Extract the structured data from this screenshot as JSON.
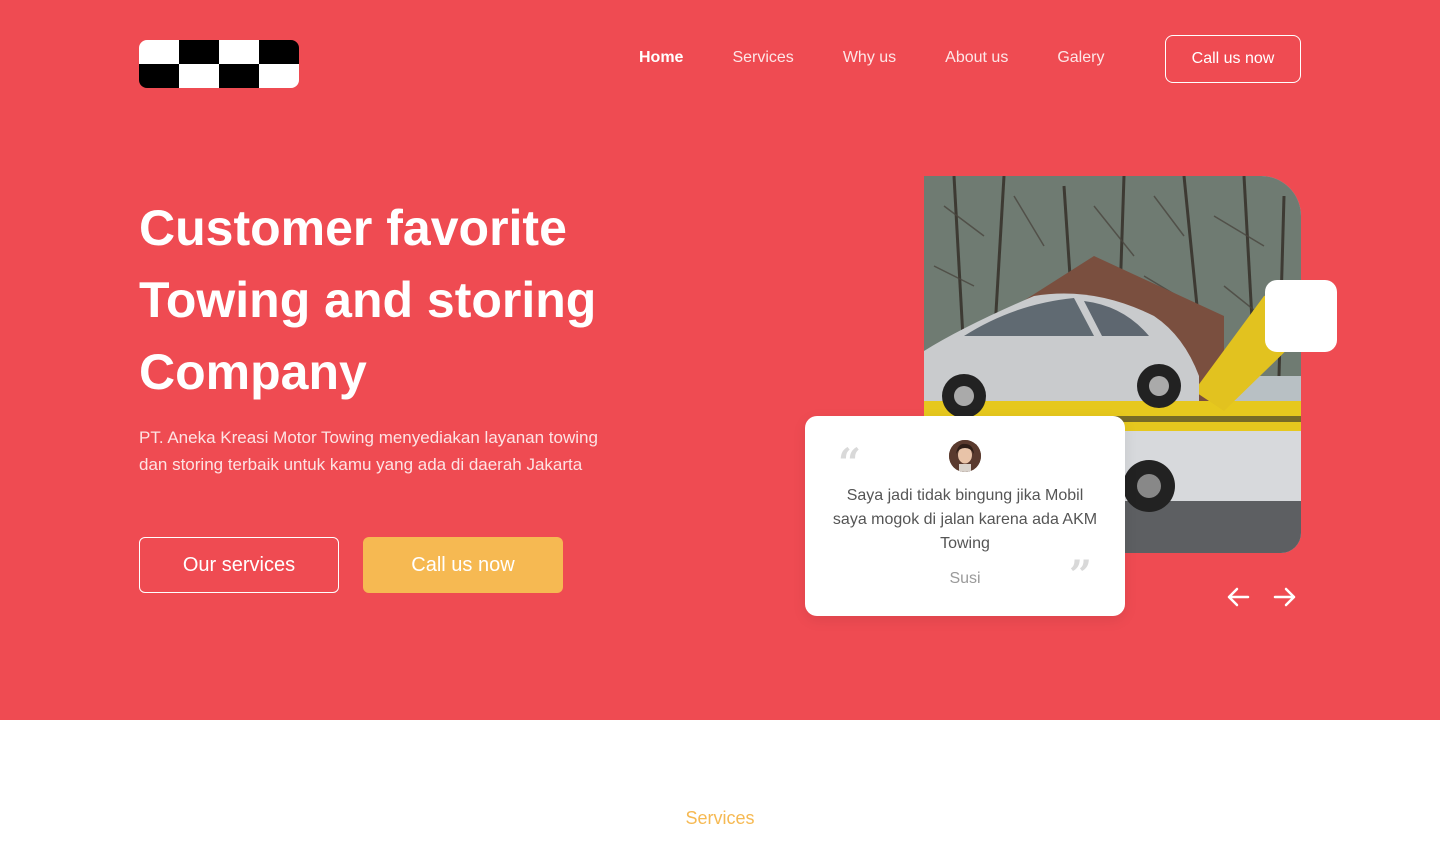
{
  "header": {
    "logo": "checkered-logo",
    "nav": [
      {
        "label": "Home",
        "active": true
      },
      {
        "label": "Services",
        "active": false
      },
      {
        "label": "Why us",
        "active": false
      },
      {
        "label": "About us",
        "active": false
      },
      {
        "label": "Galery",
        "active": false
      }
    ],
    "cta_label": "Call us now"
  },
  "hero": {
    "title_lines": [
      "Customer favorite",
      "Towing and storing",
      "Company"
    ],
    "description": "PT. Aneka Kreasi Motor Towing menyediakan layanan towing dan storing terbaik untuk kamu yang ada di daerah Jakarta",
    "primary_button": "Our services",
    "secondary_button": "Call us now"
  },
  "testimonial": {
    "quote": "Saya jadi tidak bingung jika Mobil saya mogok di jalan karena ada AKM Towing",
    "author": "Susi",
    "open_quote": "“",
    "close_quote": "”"
  },
  "carousel": {
    "prev_icon": "arrow-left-icon",
    "next_icon": "arrow-right-icon"
  },
  "section": {
    "label": "Services"
  },
  "colors": {
    "primary": "#ef4b52",
    "accent": "#f6b952",
    "white": "#ffffff"
  }
}
